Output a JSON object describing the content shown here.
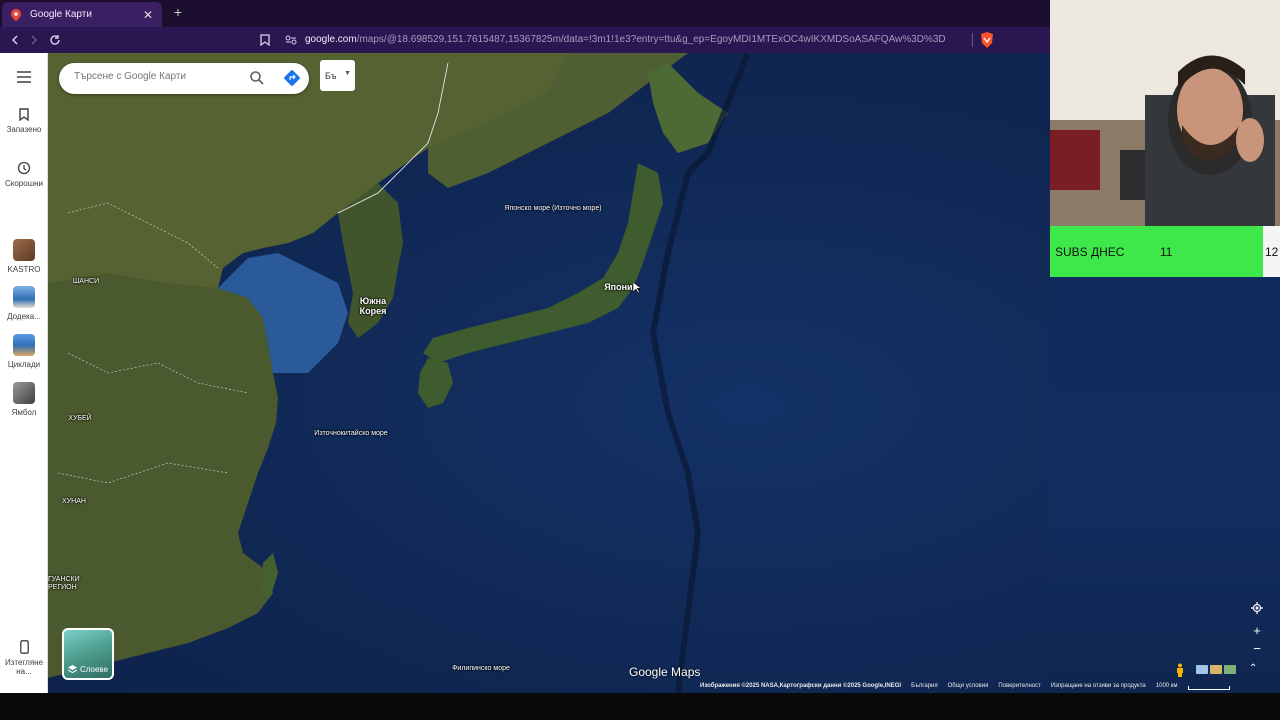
{
  "browser": {
    "tab_title": "Google Карти",
    "new_tab": "+",
    "tab_close": "✕",
    "url_host": "google.com",
    "url_path": "/maps/@18.698529,151.7615487,15367825m/data=!3m1!1e3?entry=ttu&g_ep=EgoyMDI1MTExOC4wIKXMDSoASAFQAw%3D%3D"
  },
  "sidebar": {
    "saved": "Запазено",
    "recent": "Скорошни",
    "places": [
      {
        "label": "KASTRO",
        "color": "#8a5a3c"
      },
      {
        "label": "Додека...",
        "color": "#4a86c8"
      },
      {
        "label": "Циклади",
        "color": "#c9975a"
      },
      {
        "label": "Ямбол",
        "color": "#6c6c6c"
      }
    ],
    "download": "Изтегляне на..."
  },
  "search": {
    "placeholder": "Търсене с Google Карти"
  },
  "layer_toggle": "Бъ",
  "layers_button": "Слоеве",
  "map_labels": {
    "sea_of_japan": "Японско море (Източно море)",
    "japan": "Япония",
    "south_korea": "Южна Корея",
    "shanxi": "ШАНСИ",
    "hubei": "ХУБЕЙ",
    "hunan": "ХУНАН",
    "guangxi": "ГУАНСКИ РЕГИОН",
    "east_china_sea": "Източнокитайско море",
    "philippine_sea": "Филипинско море"
  },
  "logo": "Google Maps",
  "footer": {
    "attribution": "Изображения ©2025 NASA,Картографски данни ©2025 Google,INEGI",
    "country": "България",
    "terms": "Общи условия",
    "privacy": "Поверителност",
    "feedback": "Изпращане на отзиви за продукта",
    "scale": "1000 км"
  },
  "overlay": {
    "subs_label": "SUBS ДНЕС",
    "subs_count": "11",
    "subs_goal": "12",
    "subs_color": "#3fe84a"
  }
}
